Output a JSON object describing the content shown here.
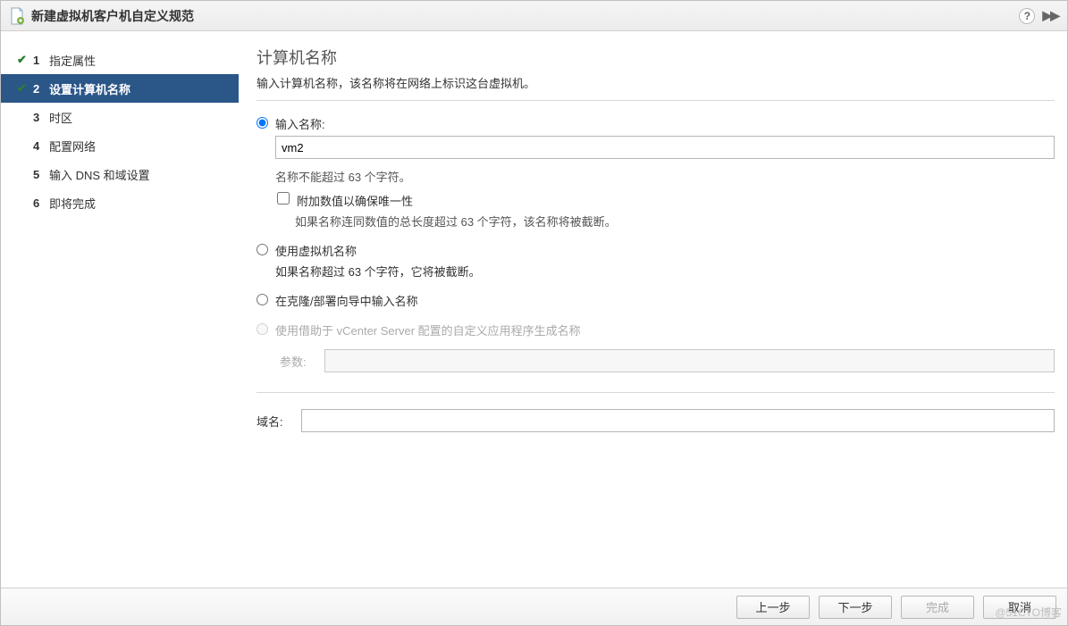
{
  "title": "新建虚拟机客户机自定义规范",
  "steps": [
    {
      "num": "1",
      "label": "指定属性",
      "state": "completed"
    },
    {
      "num": "2",
      "label": "设置计算机名称",
      "state": "active"
    },
    {
      "num": "3",
      "label": "时区",
      "state": "pending"
    },
    {
      "num": "4",
      "label": "配置网络",
      "state": "pending"
    },
    {
      "num": "5",
      "label": "输入 DNS 和域设置",
      "state": "pending"
    },
    {
      "num": "6",
      "label": "即将完成",
      "state": "pending"
    }
  ],
  "section": {
    "title": "计算机名称",
    "subtitle": "输入计算机名称，该名称将在网络上标识这台虚拟机。"
  },
  "options": {
    "enterName": {
      "label": "输入名称:",
      "value": "vm2",
      "note": "名称不能超过 63 个字符。",
      "appendCheckbox": "附加数值以确保唯一性",
      "appendNote": "如果名称连同数值的总长度超过 63 个字符，该名称将被截断。"
    },
    "useVmName": {
      "label": "使用虚拟机名称",
      "note": "如果名称超过 63 个字符，它将被截断。"
    },
    "enterInWizard": {
      "label": "在克隆/部署向导中输入名称"
    },
    "useVcenterApp": {
      "label": "使用借助于 vCenter Server 配置的自定义应用程序生成名称",
      "paramLabel": "参数:"
    }
  },
  "domain": {
    "label": "域名:",
    "value": ""
  },
  "footer": {
    "back": "上一步",
    "next": "下一步",
    "finish": "完成",
    "cancel": "取消"
  },
  "watermark": "@51CTO博客"
}
